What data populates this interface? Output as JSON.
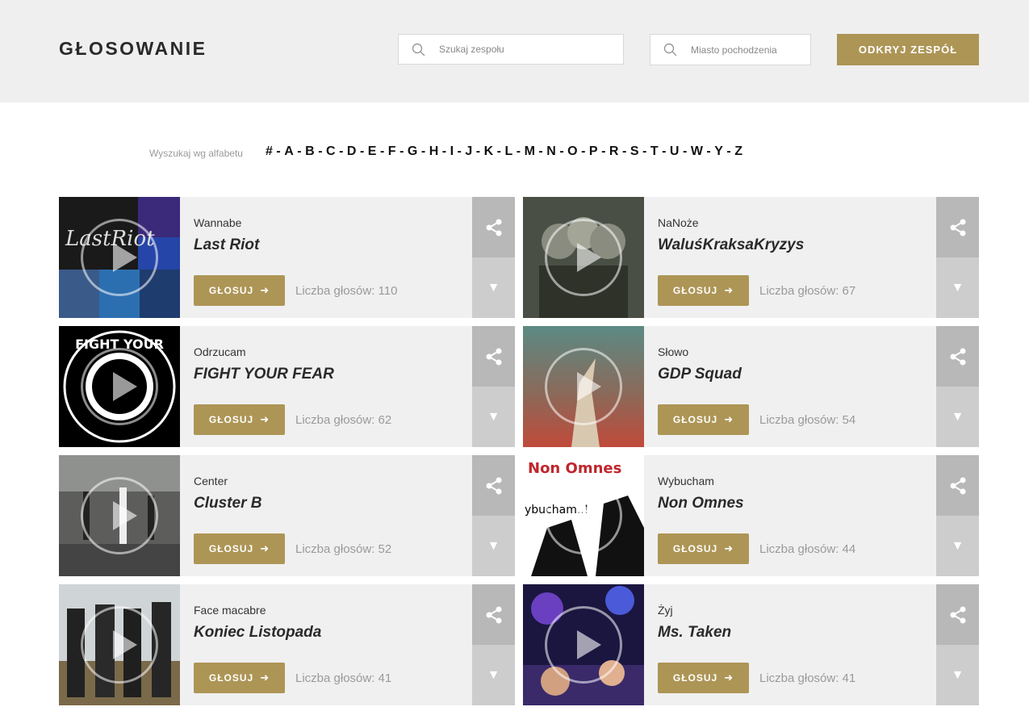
{
  "header": {
    "title": "GŁOSOWANIE",
    "search_band_placeholder": "Szukaj zespołu",
    "search_city_placeholder": "Miasto pochodzenia",
    "discover_label": "ODKRYJ ZESPÓŁ",
    "accent_color": "#ad9556"
  },
  "alphabet": {
    "label": "Wyszukaj wg alfabetu",
    "letters": [
      "#",
      "A",
      "B",
      "C",
      "D",
      "E",
      "F",
      "G",
      "H",
      "I",
      "J",
      "K",
      "L",
      "M",
      "N",
      "O",
      "P",
      "R",
      "S",
      "T",
      "U",
      "W",
      "Y",
      "Z"
    ]
  },
  "vote_label": "GŁOSUJ",
  "cards": [
    {
      "song": "Wannabe",
      "band": "Last Riot",
      "votes": "Liczba głosów: 110"
    },
    {
      "song": "NaNoże",
      "band": "WaluśKraksaKryzys",
      "votes": "Liczba głosów: 67"
    },
    {
      "song": "Odrzucam",
      "band": "FIGHT YOUR FEAR",
      "votes": "Liczba głosów: 62"
    },
    {
      "song": "Słowo",
      "band": "GDP Squad",
      "votes": "Liczba głosów: 54"
    },
    {
      "song": "Center",
      "band": "Cluster B",
      "votes": "Liczba głosów: 52"
    },
    {
      "song": "Wybucham",
      "band": "Non Omnes",
      "votes": "Liczba głosów: 44"
    },
    {
      "song": "Face macabre",
      "band": "Koniec Listopada",
      "votes": "Liczba głosów: 41"
    },
    {
      "song": "Żyj",
      "band": "Ms. Taken",
      "votes": "Liczba głosów: 41"
    }
  ]
}
